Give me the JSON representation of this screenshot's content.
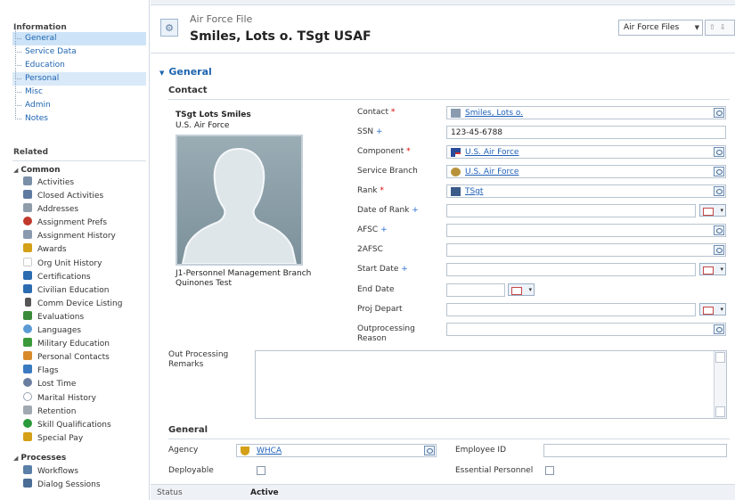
{
  "nav": {
    "information_heading": "Information",
    "sections": [
      {
        "label": "General"
      },
      {
        "label": "Service Data"
      },
      {
        "label": "Education"
      },
      {
        "label": "Personal"
      },
      {
        "label": "Misc"
      },
      {
        "label": "Admin"
      },
      {
        "label": "Notes"
      }
    ],
    "related_heading": "Related",
    "common_group": "Common",
    "related_items": [
      {
        "label": "Activities",
        "color": "#7a8fa8"
      },
      {
        "label": "Closed Activities",
        "color": "#5e7aa0"
      },
      {
        "label": "Addresses",
        "color": "#8e9caa"
      },
      {
        "label": "Assignment Prefs",
        "color": "#c0392b"
      },
      {
        "label": "Assignment History",
        "color": "#8a9bb0"
      },
      {
        "label": "Awards",
        "color": "#d4a017"
      },
      {
        "label": "Org Unit History",
        "color": "#cccccc"
      },
      {
        "label": "Certifications",
        "color": "#2b6cb0"
      },
      {
        "label": "Civilian Education",
        "color": "#2b6cb0"
      },
      {
        "label": "Comm Device Listing",
        "color": "#555555"
      },
      {
        "label": "Evaluations",
        "color": "#3a8a3a"
      },
      {
        "label": "Languages",
        "color": "#5b9bd5"
      },
      {
        "label": "Military Education",
        "color": "#3a9a3a"
      },
      {
        "label": "Personal Contacts",
        "color": "#d88a2a"
      },
      {
        "label": "Flags",
        "color": "#3a7ac0"
      },
      {
        "label": "Lost Time",
        "color": "#6a7fa0"
      },
      {
        "label": "Marital History",
        "color": "#9aa5b3"
      },
      {
        "label": "Retention",
        "color": "#a0a8b0"
      },
      {
        "label": "Skill Qualifications",
        "color": "#2a9a3a"
      },
      {
        "label": "Special Pay",
        "color": "#d4a017"
      }
    ],
    "processes_group": "Processes",
    "process_items": [
      {
        "label": "Workflows",
        "color": "#5a7fa8"
      },
      {
        "label": "Dialog Sessions",
        "color": "#4a6d96"
      }
    ]
  },
  "header": {
    "entity_type": "Air Force File",
    "record_title": "Smiles, Lots o. TSgt USAF",
    "view_selector": "Air Force Files"
  },
  "form": {
    "tab_title": "General",
    "contact_section": "Contact",
    "card": {
      "name": "TSgt Lots Smiles",
      "org": "U.S. Air Force",
      "line1": "J1-Personnel Management Branch",
      "line2": "Quinones Test"
    },
    "fields": {
      "contact_label": "Contact",
      "contact_value": "Smiles, Lots o.",
      "ssn_label": "SSN",
      "ssn_value": "123-45-6788",
      "component_label": "Component",
      "component_value": "U.S. Air Force",
      "service_branch_label": "Service Branch",
      "service_branch_value": "U.S. Air Force",
      "rank_label": "Rank",
      "rank_value": "TSgt",
      "date_of_rank_label": "Date of Rank",
      "afsc_label": "AFSC",
      "afsc2_label": "2AFSC",
      "start_date_label": "Start Date",
      "end_date_label": "End Date",
      "proj_depart_label": "Proj Depart",
      "outprocessing_label_1": "Outprocessing",
      "outprocessing_label_2": "Reason"
    },
    "remarks_label_1": "Out Processing",
    "remarks_label_2": "Remarks",
    "general_section": "General",
    "agency_label": "Agency",
    "agency_value": "WHCA",
    "employee_id_label": "Employee ID",
    "deployable_label": "Deployable",
    "essential_label": "Essential Personnel"
  },
  "status": {
    "label": "Status",
    "value": "Active"
  }
}
